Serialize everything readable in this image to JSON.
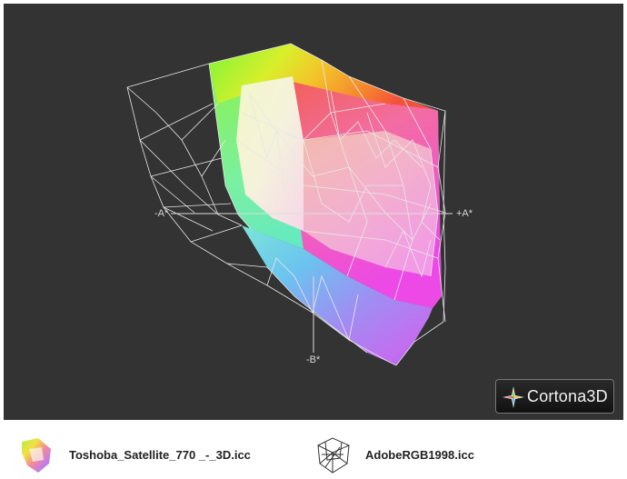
{
  "viewer": {
    "axes": {
      "minus_a": "-A*",
      "plus_a": "+A*",
      "minus_b": "-B*"
    },
    "badge": {
      "label": "Cortona3D"
    }
  },
  "legend": {
    "items": [
      {
        "label": "Toshoba_Satellite_770 _-_3D.icc",
        "icon": "color-gamut-icon"
      },
      {
        "label": "AdobeRGB1998.icc",
        "icon": "wireframe-gamut-icon"
      }
    ]
  },
  "colors": {
    "viewport_bg": "#333333",
    "wireframe": "#e6e6e6"
  }
}
